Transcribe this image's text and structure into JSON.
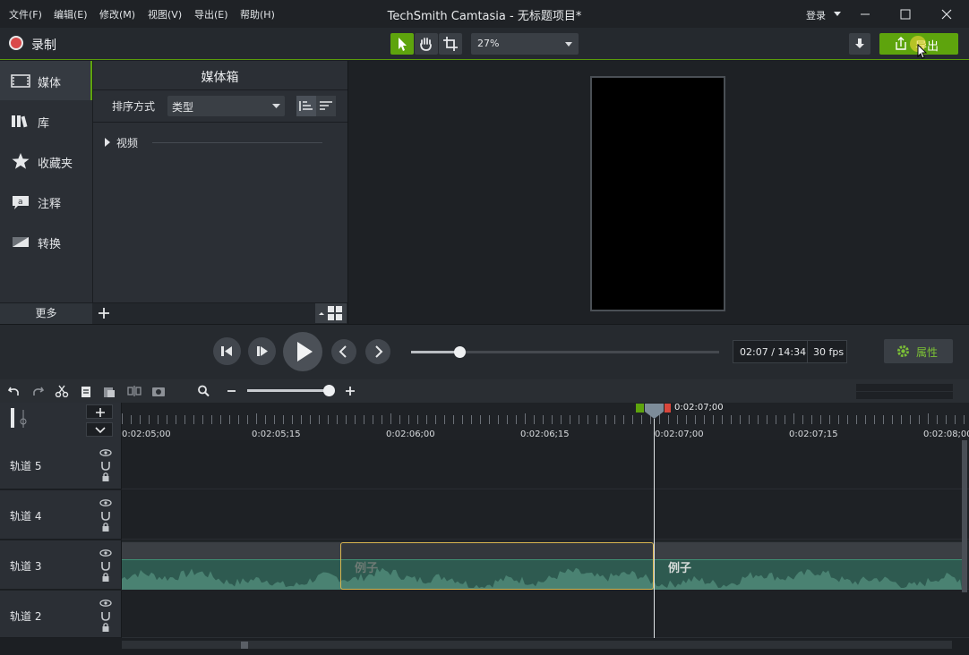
{
  "window": {
    "title": "TechSmith Camtasia - 无标题项目*",
    "menu": [
      "文件(F)",
      "编辑(E)",
      "修改(M)",
      "视图(V)",
      "导出(E)",
      "帮助(H)"
    ],
    "login": "登录"
  },
  "toolbar": {
    "record_label": "录制",
    "zoom": "27%",
    "export_label": "导出",
    "accent_color": "#5ea40d"
  },
  "left_tabs": {
    "items": [
      {
        "label": "媒体",
        "icon": "film-icon"
      },
      {
        "label": "库",
        "icon": "library-icon"
      },
      {
        "label": "收藏夹",
        "icon": "star-icon"
      },
      {
        "label": "注释",
        "icon": "annotation-icon"
      },
      {
        "label": "转换",
        "icon": "transition-icon"
      }
    ],
    "more_label": "更多"
  },
  "media_bin": {
    "title": "媒体箱",
    "sort_label": "排序方式",
    "sort_value": "类型",
    "section_label": "视频"
  },
  "playback": {
    "time": "02:07 / 14:34",
    "fps": "30 fps",
    "properties_label": "属性",
    "progress": 0.146
  },
  "timeline": {
    "playhead_time": "0:02:07;00",
    "ticks": [
      "0:02:05;00",
      "0:02:05;15",
      "0:02:06;00",
      "0:02:06;15",
      "0:02:07;00",
      "0:02:07;15",
      "0:02:08;00"
    ],
    "tracks": [
      {
        "name": "轨道 5"
      },
      {
        "name": "轨道 4"
      },
      {
        "name": "轨道 3"
      },
      {
        "name": "轨道 2"
      }
    ],
    "clip_label": "例子"
  }
}
